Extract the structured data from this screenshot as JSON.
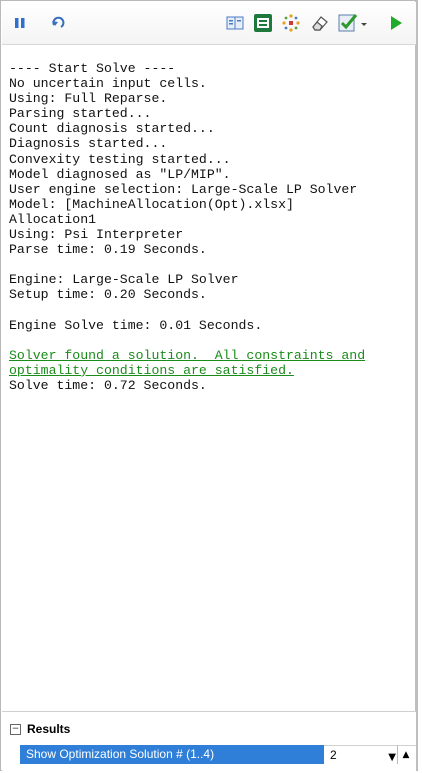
{
  "toolbar": {
    "icons": [
      "pause-icon",
      "undo-icon",
      "model-icon",
      "report-icon",
      "variables-icon",
      "eraser-icon",
      "analysis-icon",
      "run-icon"
    ],
    "colors": {
      "run": "#1faa2a",
      "accent": "#2f7fd8",
      "success": "#1a8c1a"
    }
  },
  "log": {
    "lines": [
      "---- Start Solve ----",
      "No uncertain input cells.",
      "Using: Full Reparse.",
      "Parsing started...",
      "Count diagnosis started...",
      "Diagnosis started...",
      "Convexity testing started...",
      "Model diagnosed as \"LP/MIP\".",
      "User engine selection: Large-Scale LP Solver",
      "Model: [MachineAllocation(Opt).xlsx]",
      "Allocation1",
      "Using: Psi Interpreter",
      "Parse time: 0.19 Seconds.",
      "",
      "Engine: Large-Scale LP Solver",
      "Setup time: 0.20 Seconds.",
      "",
      "Engine Solve time: 0.01 Seconds.",
      "",
      "Solver found a solution.  All constraints and",
      "optimality conditions are satisfied.",
      "Solve time: 0.72 Seconds."
    ]
  },
  "results": {
    "title": "Results",
    "toggle": "⊟",
    "row_label": "Show Optimization Solution # (1..4)",
    "row_value": "2"
  }
}
